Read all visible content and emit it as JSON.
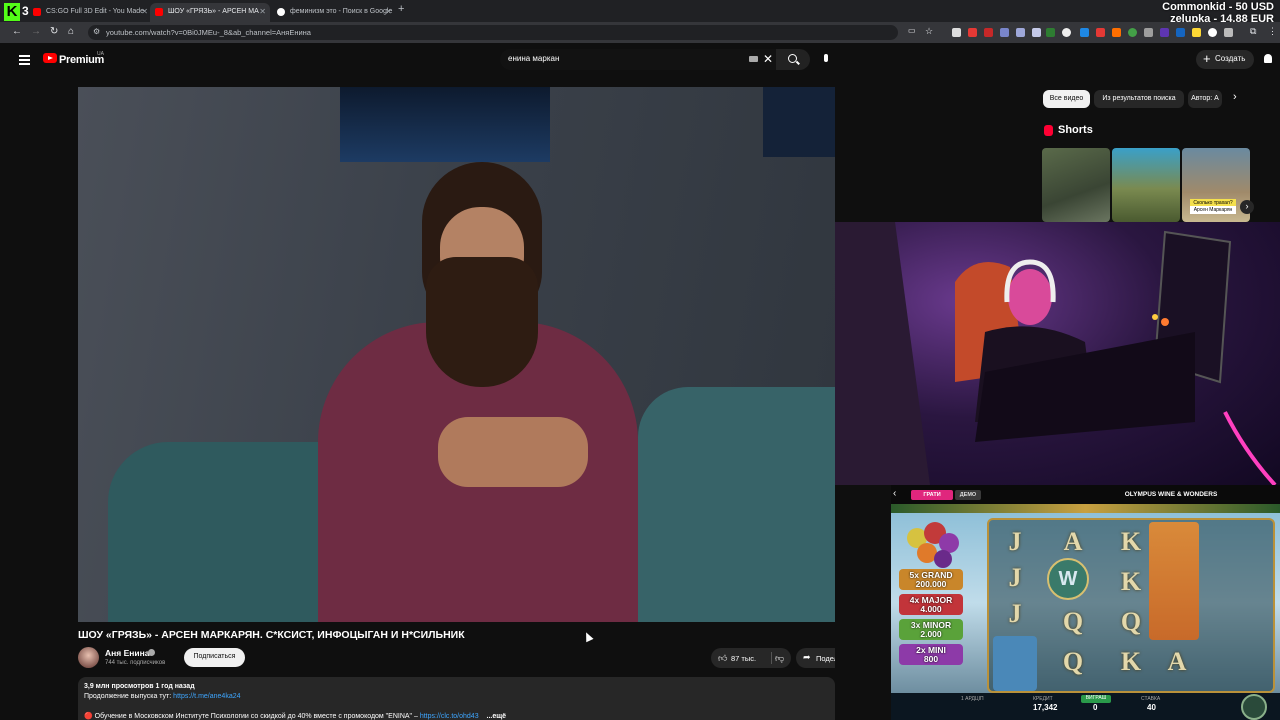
{
  "stream_overlay": {
    "kick_badge": "3",
    "line1": "Commonkid - 50 USD",
    "line2": "zelupka - 14.88 EUR"
  },
  "browser": {
    "tabs": [
      {
        "title": "CS:GO Full 3D Edit - You Made",
        "active": false,
        "favicon": "youtube-icon"
      },
      {
        "title": "ШОУ «ГРЯЗЬ» - АРСЕН МА",
        "active": true,
        "favicon": "youtube-icon"
      },
      {
        "title": "феминизм это - Поиск в Google",
        "active": false,
        "favicon": "google-icon"
      }
    ],
    "new_tab": "+",
    "url": "youtube.com/watch?v=0Bi0JMEu-_8&ab_channel=АняЕнина"
  },
  "youtube": {
    "brand": "Premium",
    "region": "UA",
    "search_value": "енина маркан",
    "create_label": "Создать"
  },
  "video": {
    "title": "ШОУ «ГРЯЗЬ» - АРСЕН МАРКАРЯН. С*КСИСТ, ИНФОЦЫГАН И Н*СИЛЬНИК",
    "channel": "Аня Енина",
    "subscribers": "744 тыс. подписчиков",
    "subscribe_label": "Подписаться",
    "likes": "87 тыс.",
    "share_label": "Поделиться",
    "stats": "3,9 млн просмотров  1 год назад",
    "desc_line1_text": "Продолжение выпуска тут: ",
    "desc_line1_link": "https://t.me/ane4ka24",
    "desc_line2_text": "🔴 Обучение в Московском Институте Психологии со скидкой до 40% вместе с промокодом \"ENINA\" – ",
    "desc_line2_link": "https://clc.to/ohd43",
    "desc_more": "...ещё"
  },
  "sidebar": {
    "chips": [
      "Все видео",
      "Из результатов поиска",
      "Автор: А"
    ],
    "shorts_title": "Shorts",
    "short3_caption": "Сколько трахал?",
    "short3_subcaption": "Арсен Маркарян"
  },
  "game": {
    "title": "OLYMPUS WINE & WONDERS",
    "mode_play": "ГРАТИ",
    "mode_demo": "ДЕМО",
    "jackpots": [
      {
        "mult": "5x",
        "name": "GRAND",
        "value": "200.000",
        "color": "#c9862a"
      },
      {
        "mult": "4x",
        "name": "MAJOR",
        "value": "4.000",
        "color": "#c2343a"
      },
      {
        "mult": "3x",
        "name": "MINOR",
        "value": "2.000",
        "color": "#5aa23a"
      },
      {
        "mult": "2x",
        "name": "MINI",
        "value": "800",
        "color": "#8d3aa8"
      }
    ],
    "credit_label": "КРЕДИТ",
    "credit_value": "17,342",
    "win_label": "ВИГРАШ",
    "win_value": "0",
    "bet_label": "СТАВКА",
    "bet_value": "40",
    "lines_label": "1 АРДЦІП"
  },
  "colors": {
    "youtube_red": "#ff0000",
    "kick_green": "#53fc18",
    "link_blue": "#3ea6ff",
    "game_pink": "#e0267d"
  }
}
